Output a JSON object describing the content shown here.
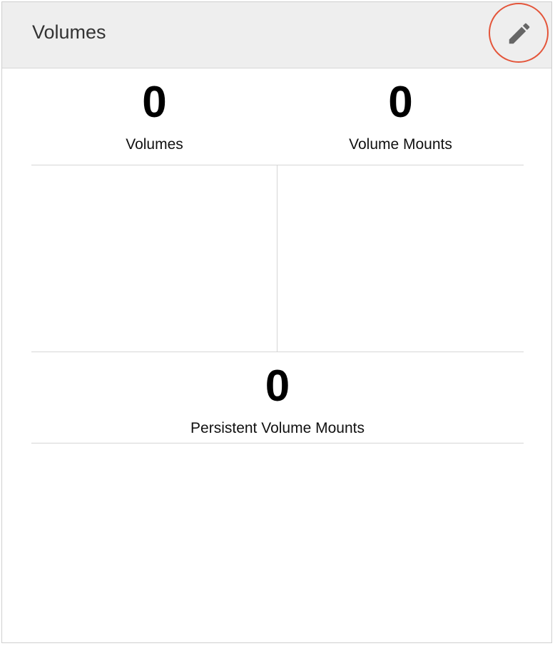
{
  "panel": {
    "title": "Volumes",
    "edit_icon": "pencil-icon",
    "highlight_color": "#e4553a"
  },
  "metrics": {
    "volumes": {
      "value": "0",
      "label": "Volumes"
    },
    "volume_mounts": {
      "value": "0",
      "label": "Volume Mounts"
    },
    "persistent_volume_mounts": {
      "value": "0",
      "label": "Persistent Volume Mounts"
    }
  }
}
